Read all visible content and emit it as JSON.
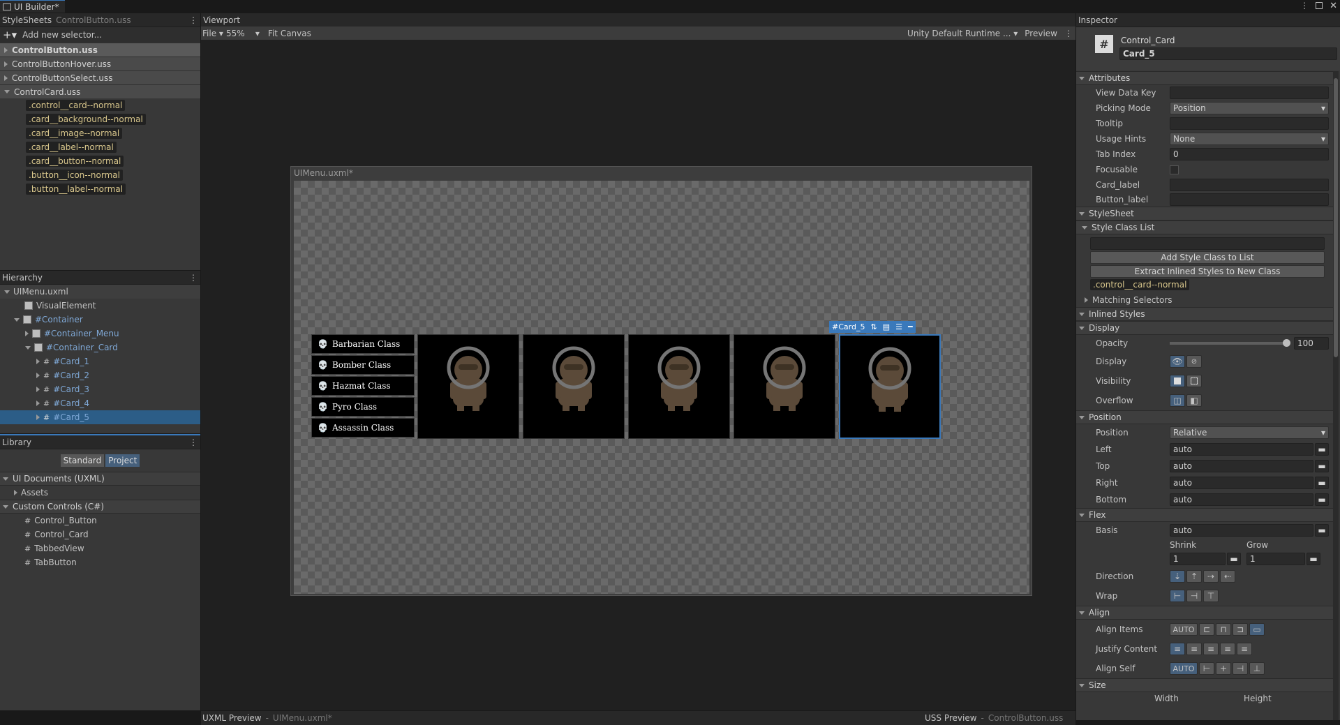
{
  "window": {
    "tab_title": "UI Builder*"
  },
  "stylesheets": {
    "title": "StyleSheets",
    "subtitle": "ControlButton.uss",
    "add_placeholder": "Add new selector...",
    "sheets": [
      "ControlButton.uss",
      "ControlButtonHover.uss",
      "ControlButtonSelect.uss",
      "ControlCard.uss"
    ],
    "selectors": [
      ".control__card--normal",
      ".card__background--normal",
      ".card__image--normal",
      ".card__label--normal",
      ".card__button--normal",
      ".button__icon--normal",
      ".button__label--normal"
    ]
  },
  "hierarchy": {
    "title": "Hierarchy",
    "root": "UIMenu.uxml",
    "items": [
      "VisualElement",
      "#Container",
      "#Container_Menu",
      "#Container_Card",
      "#Card_1",
      "#Card_2",
      "#Card_3",
      "#Card_4",
      "#Card_5"
    ]
  },
  "library": {
    "title": "Library",
    "tab_standard": "Standard",
    "tab_project": "Project",
    "section_uxml": "UI Documents (UXML)",
    "assets": "Assets",
    "section_custom": "Custom Controls (C#)",
    "custom": [
      "Control_Button",
      "Control_Card",
      "TabbedView",
      "TabButton"
    ]
  },
  "viewport": {
    "title": "Viewport",
    "file_menu": "File",
    "zoom": "55%",
    "fit": "Fit Canvas",
    "theme": "Unity Default Runtime ...",
    "preview": "Preview",
    "canvas_title": "UIMenu.uxml*",
    "menu_items": [
      "Barbarian Class",
      "Bomber Class",
      "Hazmat Class",
      "Pyro Class",
      "Assassin Class"
    ],
    "selected_label": "#Card_5"
  },
  "bottom": {
    "uxml_preview": "UXML Preview",
    "uxml_file": "UIMenu.uxml*",
    "uss_preview": "USS Preview",
    "uss_file": "ControlButton.uss"
  },
  "inspector": {
    "title": "Inspector",
    "element_type": "Control_Card",
    "element_name": "Card_5",
    "attributes": {
      "header": "Attributes",
      "view_data_key": "View Data Key",
      "picking_mode": "Picking Mode",
      "picking_mode_value": "Position",
      "tooltip": "Tooltip",
      "usage_hints": "Usage Hints",
      "usage_hints_value": "None",
      "tab_index": "Tab Index",
      "tab_index_value": "0",
      "focusable": "Focusable",
      "card_label": "Card_label",
      "button_label": "Button_label"
    },
    "stylesheet": {
      "header": "StyleSheet",
      "class_list": "Style Class List",
      "add_class": "Add Style Class to List",
      "extract": "Extract Inlined Styles to New Class",
      "class_chip": ".control__card--normal",
      "matching": "Matching Selectors"
    },
    "inlined": "Inlined Styles",
    "display": {
      "header": "Display",
      "opacity": "Opacity",
      "opacity_value": "100",
      "display": "Display",
      "visibility": "Visibility",
      "overflow": "Overflow"
    },
    "position": {
      "header": "Position",
      "position": "Position",
      "position_value": "Relative",
      "left": "Left",
      "top": "Top",
      "right": "Right",
      "bottom": "Bottom",
      "auto": "auto"
    },
    "flex": {
      "header": "Flex",
      "basis": "Basis",
      "basis_value": "auto",
      "shrink": "Shrink",
      "grow": "Grow",
      "shrink_value": "1",
      "grow_value": "1",
      "direction": "Direction",
      "wrap": "Wrap"
    },
    "align": {
      "header": "Align",
      "align_items": "Align Items",
      "justify": "Justify Content",
      "align_self": "Align Self",
      "auto": "AUTO"
    },
    "size": {
      "header": "Size",
      "width": "Width",
      "height": "Height"
    }
  }
}
